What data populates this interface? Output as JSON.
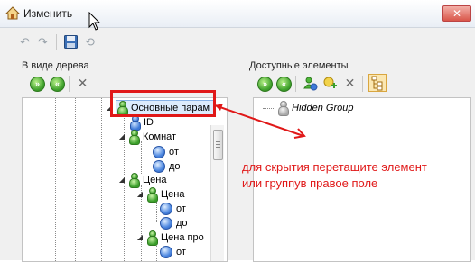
{
  "window": {
    "title": "Изменить",
    "close_label": "✕"
  },
  "left_panel": {
    "label": "В виде дерева",
    "tree": {
      "root_label": "Основные парам",
      "items": [
        {
          "label": "ID"
        },
        {
          "label": "Комнат"
        },
        {
          "label": "от"
        },
        {
          "label": "до"
        },
        {
          "label": "Цена"
        },
        {
          "label": "Цена"
        },
        {
          "label": "от"
        },
        {
          "label": "до"
        },
        {
          "label": "Цена про"
        },
        {
          "label": "от"
        }
      ]
    }
  },
  "right_panel": {
    "label": "Доступные элементы",
    "tree": {
      "items": [
        {
          "label": "Hidden Group"
        }
      ]
    }
  },
  "annotation": {
    "line1": "для скрытия перетащите элемент",
    "line2": "или группув правое поле",
    "color": "#e01818"
  }
}
